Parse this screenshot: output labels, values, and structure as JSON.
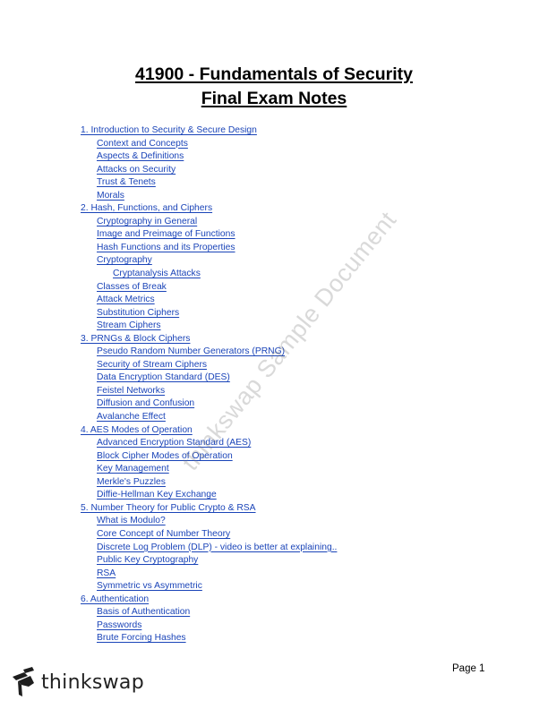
{
  "document": {
    "title_line_1": "41900 - Fundamentals of Security",
    "title_line_2": "Final Exam Notes",
    "link_color": "#1a44b8"
  },
  "toc": [
    {
      "level": 1,
      "label": "1. Introduction to Security & Secure Design"
    },
    {
      "level": 2,
      "label": "Context and Concepts"
    },
    {
      "level": 2,
      "label": "Aspects & Definitions"
    },
    {
      "level": 2,
      "label": "Attacks on Security"
    },
    {
      "level": 2,
      "label": "Trust & Tenets"
    },
    {
      "level": 2,
      "label": "Morals"
    },
    {
      "level": 1,
      "label": "2. Hash, Functions, and Ciphers"
    },
    {
      "level": 2,
      "label": "Cryptography in General"
    },
    {
      "level": 2,
      "label": "Image and Preimage of Functions"
    },
    {
      "level": 2,
      "label": "Hash Functions and its Properties"
    },
    {
      "level": 2,
      "label": "Cryptography"
    },
    {
      "level": 3,
      "label": "Cryptanalysis Attacks"
    },
    {
      "level": 2,
      "label": "Classes of Break"
    },
    {
      "level": 2,
      "label": "Attack Metrics"
    },
    {
      "level": 2,
      "label": "Substitution Ciphers"
    },
    {
      "level": 2,
      "label": "Stream Ciphers"
    },
    {
      "level": 1,
      "label": "3. PRNGs & Block Ciphers"
    },
    {
      "level": 2,
      "label": "Pseudo Random Number Generators (PRNG)"
    },
    {
      "level": 2,
      "label": "Security of Stream Ciphers"
    },
    {
      "level": 2,
      "label": "Data Encryption Standard (DES)"
    },
    {
      "level": 2,
      "label": "Feistel Networks"
    },
    {
      "level": 2,
      "label": "Diffusion and Confusion"
    },
    {
      "level": 2,
      "label": "Avalanche Effect"
    },
    {
      "level": 1,
      "label": "4. AES Modes of Operation"
    },
    {
      "level": 2,
      "label": "Advanced Encryption Standard (AES)"
    },
    {
      "level": 2,
      "label": "Block Cipher Modes of Operation"
    },
    {
      "level": 2,
      "label": "Key Management"
    },
    {
      "level": 2,
      "label": "Merkle's Puzzles"
    },
    {
      "level": 2,
      "label": "Diffie-Hellman Key Exchange"
    },
    {
      "level": 1,
      "label": "5. Number Theory for Public Crypto & RSA"
    },
    {
      "level": 2,
      "label": "What is Modulo?"
    },
    {
      "level": 2,
      "label": "Core Concept of Number Theory"
    },
    {
      "level": 2,
      "label": "Discrete Log Problem (DLP) - video is better at explaining.."
    },
    {
      "level": 2,
      "label": "Public Key Cryptography"
    },
    {
      "level": 2,
      "label": "RSA"
    },
    {
      "level": 2,
      "label": "Symmetric vs Asymmetric"
    },
    {
      "level": 1,
      "label": "6. Authentication"
    },
    {
      "level": 2,
      "label": "Basis of Authentication"
    },
    {
      "level": 2,
      "label": "Passwords"
    },
    {
      "level": 2,
      "label": "Brute Forcing Hashes"
    }
  ],
  "watermark": {
    "text": "thinkswap Sample Document"
  },
  "footer": {
    "logo_icon": "thinkswap-logo-icon",
    "brand": "thinkswap",
    "page_label": "Page 1"
  }
}
